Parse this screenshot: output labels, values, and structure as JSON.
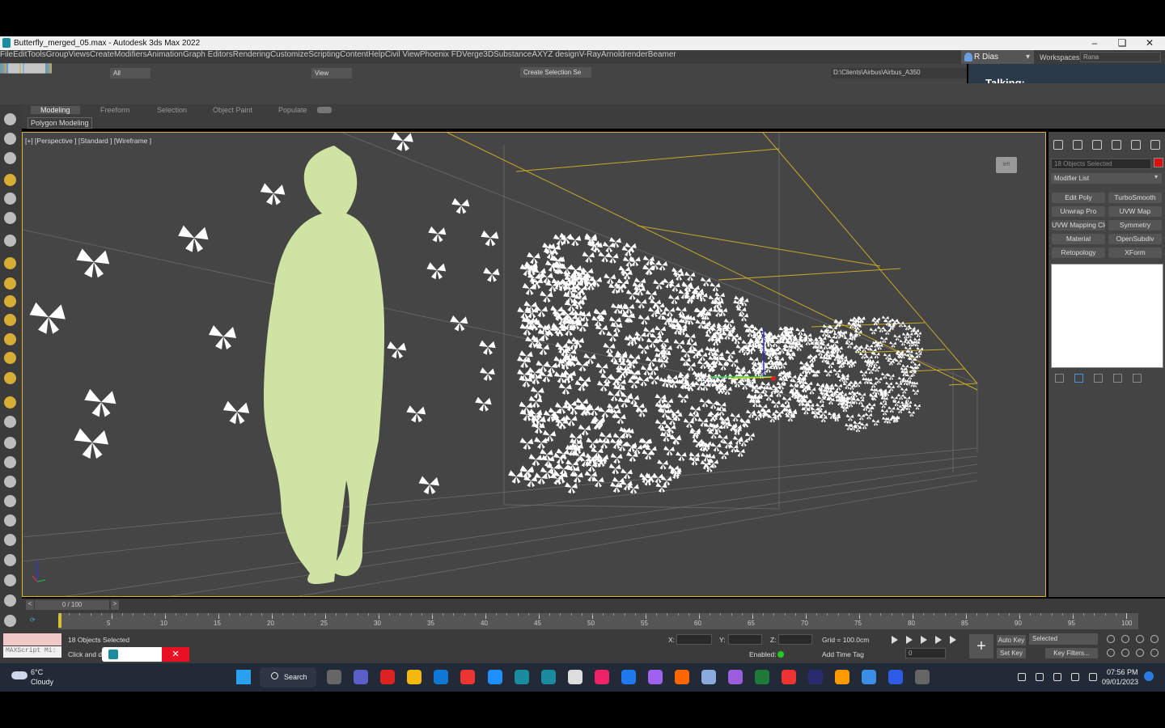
{
  "window": {
    "title": "Butterfly_merged_05.max - Autodesk 3ds Max 2022",
    "minimize": "–",
    "maximize": "❏",
    "close": "✕"
  },
  "menu": [
    "File",
    "Edit",
    "Tools",
    "Group",
    "Views",
    "Create",
    "Modifiers",
    "Animation",
    "Graph Editors",
    "Rendering",
    "Customize",
    "Scripting",
    "Content",
    "Help",
    "Civil View",
    "Phoenix FD",
    "Verge3D",
    "Substance",
    "AXYZ design",
    "V-Ray",
    "Arnold",
    "renderBeamer"
  ],
  "user": {
    "name": "R Dias",
    "workspaces_label": "Workspaces:",
    "workspace": "Rana"
  },
  "toolbar": {
    "filter": "All",
    "view": "View",
    "selection_set": "Create Selection Se",
    "path": "D:\\Clients\\Airbus\\Airbus_A350"
  },
  "notification": {
    "text": "Talking:"
  },
  "ribbon": {
    "tabs": [
      "Modeling",
      "Freeform",
      "Selection",
      "Object Paint",
      "Populate"
    ],
    "active": "Modeling",
    "subtab": "Polygon Modeling"
  },
  "viewport": {
    "label": "[+] [Perspective ] [Standard ] [Wireframe ]",
    "cube_label": "left"
  },
  "command_panel": {
    "selection": "18 Objects Selected",
    "color": "#dd1111",
    "modifier_list": "Modifier List",
    "buttons": [
      "Edit Poly",
      "TurboSmooth",
      "Unwrap Pro",
      "UVW Map",
      "UVW Mapping Clear",
      "Symmetry",
      "Material",
      "OpenSubdiv",
      "Retopology",
      "XForm"
    ]
  },
  "timeline": {
    "frame": "0 / 100",
    "ticks": [
      "5",
      "10",
      "15",
      "20",
      "25",
      "30",
      "35",
      "40",
      "45",
      "50",
      "55",
      "60",
      "65",
      "70",
      "75",
      "80",
      "85",
      "90",
      "95",
      "100"
    ]
  },
  "status": {
    "selected": "18 Objects Selected",
    "prompt": "Click and dr",
    "maxscript": "MAXScript Mi:",
    "x_label": "X:",
    "y_label": "Y:",
    "z_label": "Z:",
    "grid": "Grid = 100.0cm",
    "enabled": "Enabled:",
    "add_time_tag": "Add Time Tag",
    "auto_key": "Auto Key",
    "set_key": "Set Key",
    "key_mode": "Selected",
    "key_filters": "Key Filters...",
    "frame_field": "0"
  },
  "taskbar": {
    "weather_temp": "6°C",
    "weather_desc": "Cloudy",
    "search": "Search",
    "time": "07:56 PM",
    "date": "09/01/2023"
  }
}
